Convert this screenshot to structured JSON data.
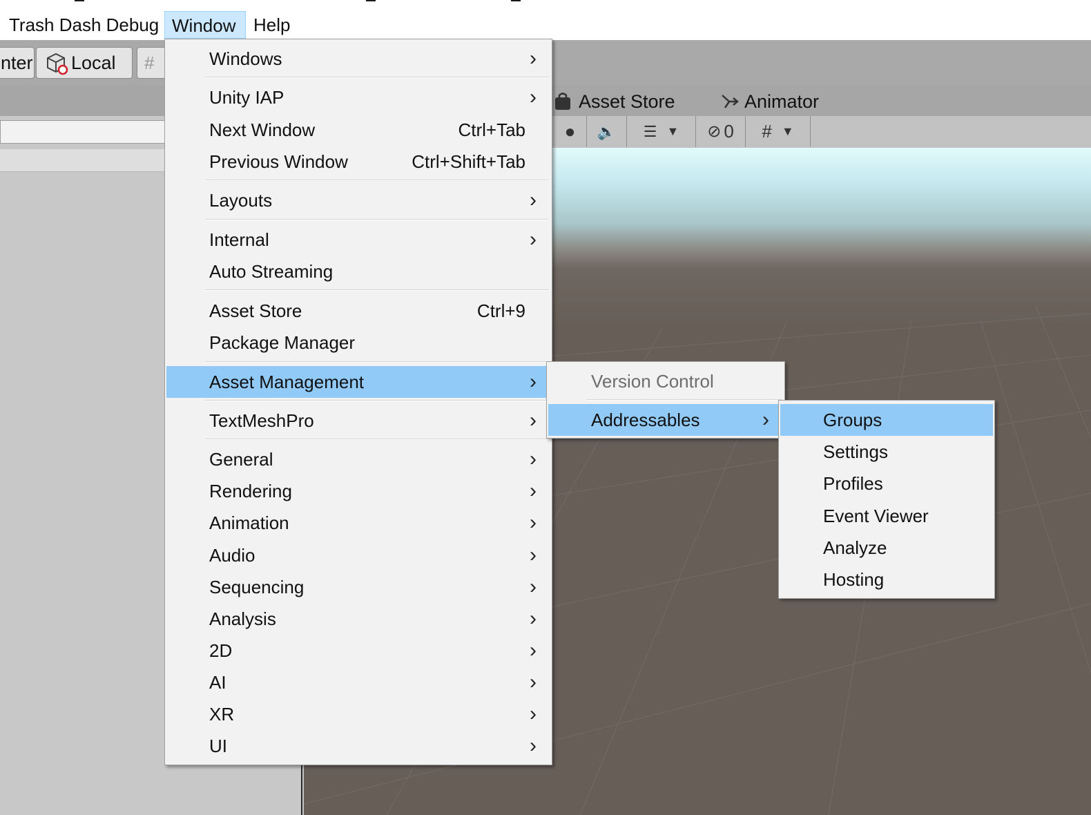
{
  "menubar": {
    "items": [
      "Trash Dash Debug",
      "Window",
      "Help"
    ],
    "active_index": 1
  },
  "toolbar": {
    "pivot_label": "nter",
    "space_label": "Local"
  },
  "scene": {
    "tabs": [
      "Asset Store",
      "Animator"
    ],
    "hidden_count": "0"
  },
  "window_menu": {
    "items": [
      {
        "label": "Windows",
        "submenu": true
      },
      {
        "label": "Unity IAP",
        "submenu": true
      },
      {
        "label": "Next Window",
        "shortcut": "Ctrl+Tab"
      },
      {
        "label": "Previous Window",
        "shortcut": "Ctrl+Shift+Tab"
      },
      {
        "label": "Layouts",
        "submenu": true
      },
      {
        "label": "Internal",
        "submenu": true
      },
      {
        "label": "Auto Streaming"
      },
      {
        "label": "Asset Store",
        "shortcut": "Ctrl+9"
      },
      {
        "label": "Package Manager"
      },
      {
        "label": "Asset Management",
        "submenu": true,
        "highlighted": true
      },
      {
        "label": "TextMeshPro",
        "submenu": true
      },
      {
        "label": "General",
        "submenu": true
      },
      {
        "label": "Rendering",
        "submenu": true
      },
      {
        "label": "Animation",
        "submenu": true
      },
      {
        "label": "Audio",
        "submenu": true
      },
      {
        "label": "Sequencing",
        "submenu": true
      },
      {
        "label": "Analysis",
        "submenu": true
      },
      {
        "label": "2D",
        "submenu": true
      },
      {
        "label": "AI",
        "submenu": true
      },
      {
        "label": "XR",
        "submenu": true
      },
      {
        "label": "UI",
        "submenu": true
      }
    ]
  },
  "asset_management_menu": {
    "items": [
      {
        "label": "Version Control",
        "disabled": true
      },
      {
        "label": "Addressables",
        "submenu": true,
        "highlighted": true
      }
    ]
  },
  "addressables_menu": {
    "items": [
      {
        "label": "Groups",
        "highlighted": true
      },
      {
        "label": "Settings"
      },
      {
        "label": "Profiles"
      },
      {
        "label": "Event Viewer"
      },
      {
        "label": "Analyze"
      },
      {
        "label": "Hosting"
      }
    ]
  },
  "colors": {
    "menu_highlight": "#91c9f7",
    "menubar_active": "#cce8ff",
    "menu_background": "#f2f2f2"
  },
  "icons": {
    "submenu_arrow": "chevron-right-icon",
    "asset_store_tab": "shopping-bag-icon",
    "animator_tab": "animator-icon",
    "local_space": "cube-icon"
  }
}
